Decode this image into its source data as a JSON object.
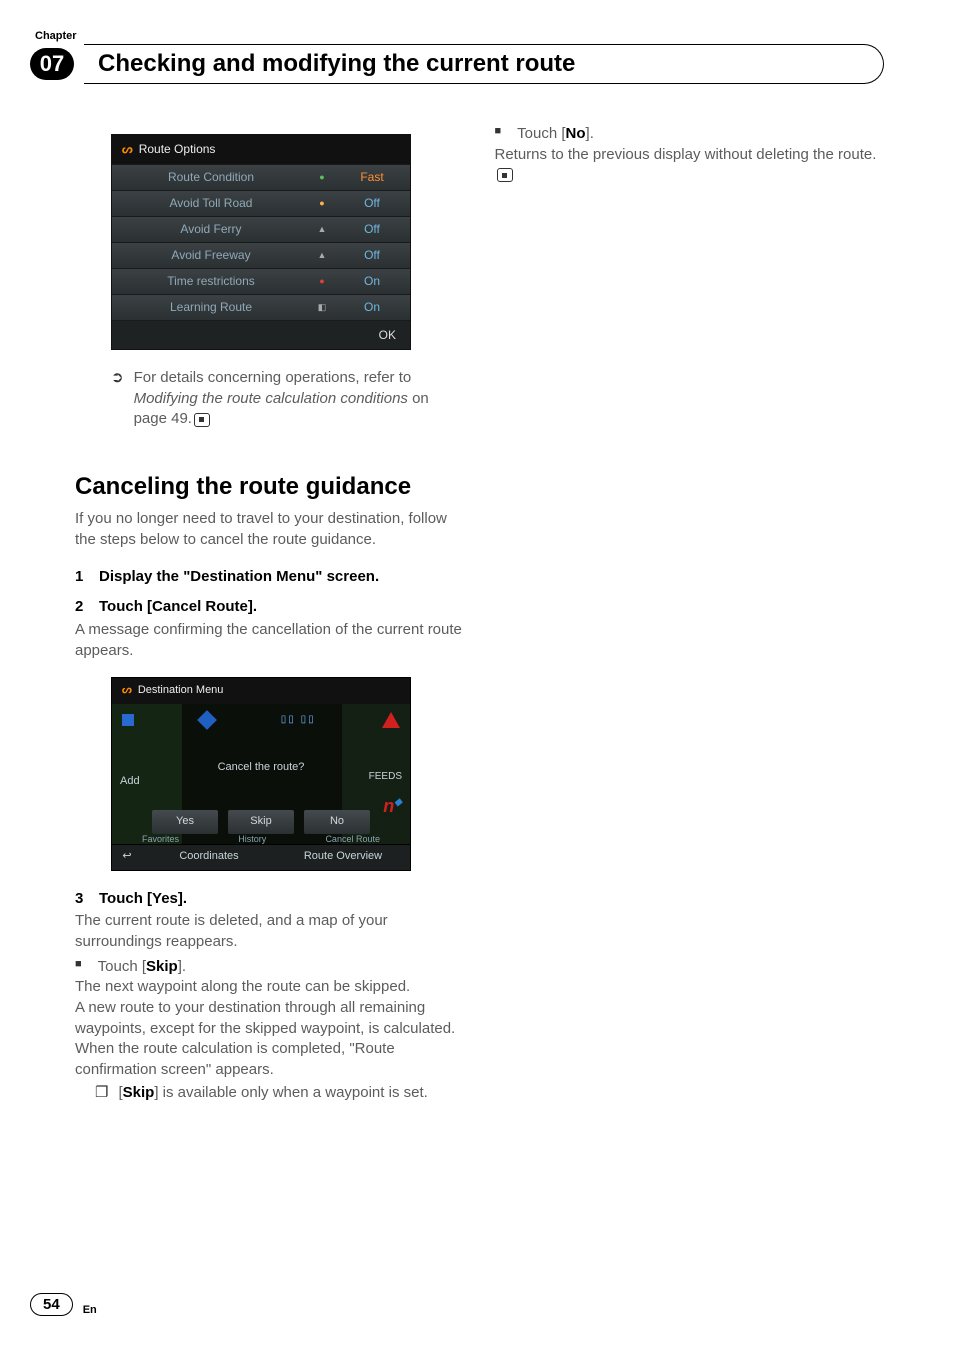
{
  "header": {
    "chapter_label": "Chapter",
    "chapter_number": "07",
    "chapter_title": "Checking and modifying the current route"
  },
  "route_options_shot": {
    "title": "Route Options",
    "rows": [
      {
        "label": "Route Condition",
        "icon": "●",
        "icon_class": "ic-green",
        "value": "Fast",
        "val_class": "val-orange"
      },
      {
        "label": "Avoid Toll Road",
        "icon": "●",
        "icon_class": "ic-orange",
        "value": "Off",
        "val_class": "val-blue"
      },
      {
        "label": "Avoid Ferry",
        "icon": "▲",
        "icon_class": "ic-gray",
        "value": "Off",
        "val_class": "val-blue"
      },
      {
        "label": "Avoid Freeway",
        "icon": "▲",
        "icon_class": "ic-gray",
        "value": "Off",
        "val_class": "val-blue"
      },
      {
        "label": "Time restrictions",
        "icon": "●",
        "icon_class": "ic-red",
        "value": "On",
        "val_class": "val-blue"
      },
      {
        "label": "Learning Route",
        "icon": "◧",
        "icon_class": "ic-gray",
        "value": "On",
        "val_class": "val-blue"
      }
    ],
    "ok": "OK"
  },
  "left": {
    "note1_a": "For details concerning operations, refer to ",
    "note1_b": "Modifying the route calculation conditions",
    "note1_c": " on page 49.",
    "section_title": "Canceling the route guidance",
    "intro": "If you no longer need to travel to your destination, follow the steps below to cancel the route guidance.",
    "step1": "Display the \"Destination Menu\" screen.",
    "step2": "Touch [Cancel Route].",
    "after_step2": "A message confirming the cancellation of the current route appears.",
    "step3": "Touch [Yes].",
    "after_step3": "The current route is deleted, and a map of your surroundings reappears.",
    "touch_skip_pre": "Touch [",
    "touch_skip_bold": "Skip",
    "touch_skip_post": "].",
    "skip_p1": "The next waypoint along the route can be skipped.",
    "skip_p2": "A new route to your destination through all remaining waypoints, except for the skipped waypoint, is calculated.",
    "skip_p3": "When the route calculation is completed, \"Route confirmation screen\" appears.",
    "skip_note_pre": "[",
    "skip_note_bold": "Skip",
    "skip_note_post": "] is available only when a waypoint is set."
  },
  "dest_shot": {
    "title": "Destination Menu",
    "side_left": "Add",
    "side_right": "FEEDS",
    "modal_text": "Cancel the route?",
    "yes": "Yes",
    "skip": "Skip",
    "no": "No",
    "fav": "Favorites",
    "hist": "History",
    "cancel": "Cancel Route",
    "back": "↩",
    "side_n": "n",
    "coords": "Coordinates",
    "overview": "Route Overview"
  },
  "right": {
    "touch_no_pre": "Touch [",
    "touch_no_bold": "No",
    "touch_no_post": "].",
    "no_body": "Returns to the previous display without deleting the route."
  },
  "footer": {
    "page": "54",
    "lang": "En"
  }
}
